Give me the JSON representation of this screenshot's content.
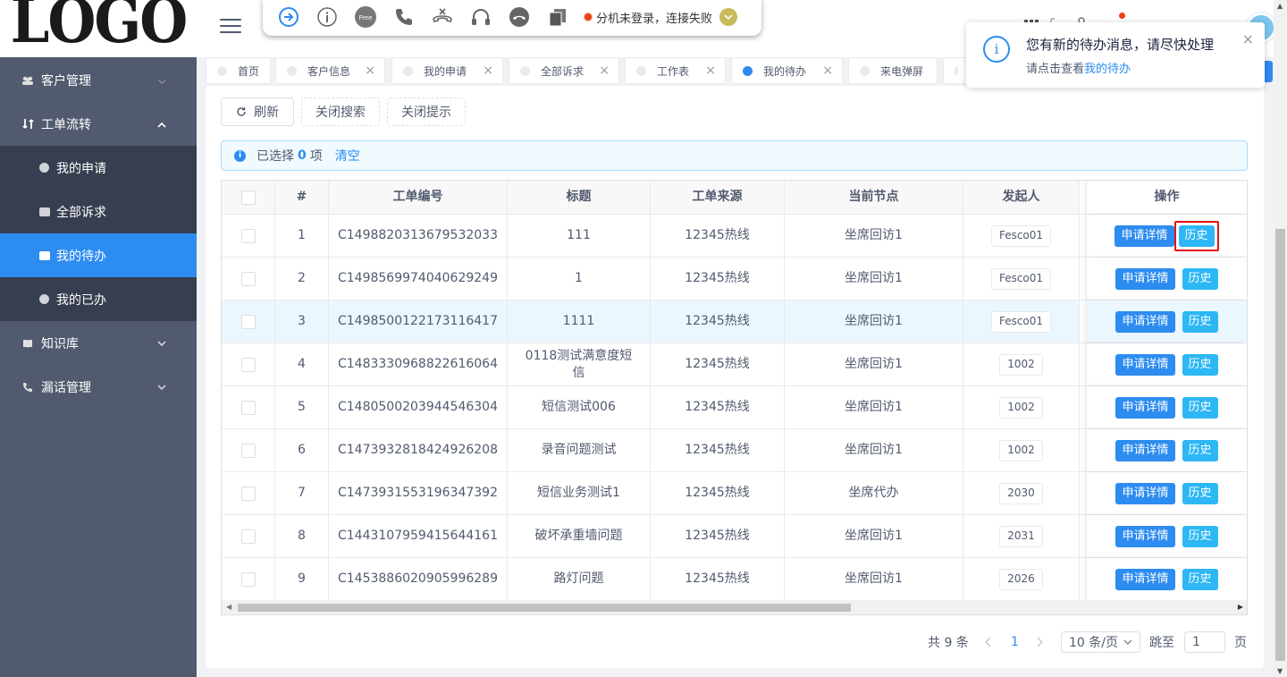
{
  "app": {
    "logo_text": "LOGO"
  },
  "sidebar": {
    "items": [
      {
        "label": "客户管理",
        "icon": "users-icon",
        "expanded": false
      },
      {
        "label": "工单流转",
        "icon": "transfer-icon",
        "expanded": true
      },
      {
        "label": "知识库",
        "icon": "book-icon",
        "expanded": false
      },
      {
        "label": "漏话管理",
        "icon": "phone-icon",
        "expanded": false
      }
    ],
    "submenu": [
      {
        "label": "我的申请",
        "icon": "circle-icon"
      },
      {
        "label": "全部诉求",
        "icon": "folder-icon"
      },
      {
        "label": "我的待办",
        "icon": "square-icon",
        "active": true
      },
      {
        "label": "我的已办",
        "icon": "circle-icon"
      }
    ]
  },
  "phonebar": {
    "free_label": "Free",
    "status_text": "分机未登录，连接失败",
    "status_color": "#ed4014"
  },
  "tabs": [
    {
      "label": "首页",
      "closable": false
    },
    {
      "label": "客户信息",
      "closable": true
    },
    {
      "label": "我的申请",
      "closable": true
    },
    {
      "label": "全部诉求",
      "closable": true
    },
    {
      "label": "工作表",
      "closable": true
    },
    {
      "label": "我的待办",
      "closable": true,
      "active": true
    },
    {
      "label": "来电弹屏",
      "closable": false
    }
  ],
  "toolbar": {
    "refresh_label": "刷新",
    "close_search_label": "关闭搜索",
    "close_tips_label": "关闭提示"
  },
  "selection": {
    "prefix": "已选择",
    "count": "0",
    "suffix": "项",
    "clear_label": "清空"
  },
  "table": {
    "headers": [
      "#",
      "工单编号",
      "标题",
      "工单来源",
      "当前节点",
      "发起人",
      "操作"
    ],
    "detail_label": "申请详情",
    "history_label": "历史",
    "rows": [
      {
        "no": "1",
        "id": "C1498820313679532033",
        "title": "111",
        "source": "12345热线",
        "node": "坐席回访1",
        "initiator": "Fesco01"
      },
      {
        "no": "2",
        "id": "C1498569974040629249",
        "title": "1",
        "source": "12345热线",
        "node": "坐席回访1",
        "initiator": "Fesco01"
      },
      {
        "no": "3",
        "id": "C1498500122173116417",
        "title": "1111",
        "source": "12345热线",
        "node": "坐席回访1",
        "initiator": "Fesco01"
      },
      {
        "no": "4",
        "id": "C1483330968822616064",
        "title": "0118测试满意度短信",
        "source": "12345热线",
        "node": "坐席回访1",
        "initiator": "1002"
      },
      {
        "no": "5",
        "id": "C1480500203944546304",
        "title": "短信测试006",
        "source": "12345热线",
        "node": "坐席回访1",
        "initiator": "1002"
      },
      {
        "no": "6",
        "id": "C1473932818424926208",
        "title": "录音问题测试",
        "source": "12345热线",
        "node": "坐席回访1",
        "initiator": "1002"
      },
      {
        "no": "7",
        "id": "C1473931553196347392",
        "title": "短信业务测试1",
        "source": "12345热线",
        "node": "坐席代办",
        "initiator": "2030"
      },
      {
        "no": "8",
        "id": "C1443107959415644161",
        "title": "破坏承重墙问题",
        "source": "12345热线",
        "node": "坐席回访1",
        "initiator": "2031"
      },
      {
        "no": "9",
        "id": "C1453886020905996289",
        "title": "路灯问题",
        "source": "12345热线",
        "node": "坐席回访1",
        "initiator": "2026"
      }
    ]
  },
  "pagination": {
    "total_text": "共 9 条",
    "current_page": "1",
    "page_size_label": "10 条/页",
    "jump_label": "跳至",
    "jump_value": "1",
    "page_unit": "页"
  },
  "notification": {
    "title": "您有新的待办消息，请尽快处理",
    "desc_prefix": "请点击查看",
    "desc_link": "我的待办"
  },
  "colors": {
    "primary": "#2d8cf0",
    "info": "#2db7f5",
    "sidebar_bg": "#515a6e",
    "submenu_bg": "#363e4f",
    "highlight_border": "#e0140f"
  }
}
